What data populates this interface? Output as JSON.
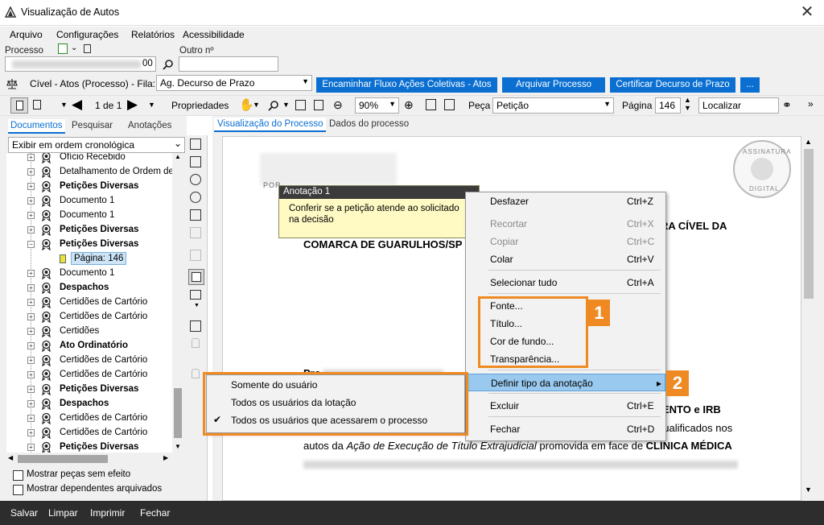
{
  "window": {
    "title": "Visualização de Autos",
    "close_glyph": "✕"
  },
  "menu": [
    "Arquivo",
    "Configurações",
    "Relatórios",
    "Acessibilidade"
  ],
  "fields": {
    "processo_label": "Processo",
    "processo_value": "00",
    "outro_label": "Outro nº",
    "outro_value": ""
  },
  "row2": {
    "context": "Cível - Atos (Processo) - Fila:",
    "fila_value": "Ag. Decurso de Prazo",
    "buttons": [
      "Encaminhar Fluxo Ações Coletivas - Atos",
      "Arquivar Processo",
      "Certificar Decurso de Prazo",
      "..."
    ]
  },
  "toolbar": {
    "page_counter": "1 de 1",
    "propriedades": "Propriedades",
    "zoom": "90%",
    "peca_label": "Peça",
    "peca_value": "Petição",
    "pagina_label": "Página",
    "pagina_value": "146",
    "localizar": "Localizar"
  },
  "left_tabs": [
    "Documentos",
    "Pesquisar",
    "Anotações"
  ],
  "order_select": "Exibir em ordem cronológica",
  "tree": [
    {
      "label": "Ofício Recebido",
      "bold": false
    },
    {
      "label": "Detalhamento de Ordem de",
      "bold": false
    },
    {
      "label": "Petições Diversas",
      "bold": true
    },
    {
      "label": "Documento 1",
      "bold": false
    },
    {
      "label": "Documento 1",
      "bold": false
    },
    {
      "label": "Petições Diversas",
      "bold": true
    },
    {
      "label": "Petições Diversas",
      "bold": true,
      "expanded": true
    },
    {
      "label": "Página: 146",
      "bold": false,
      "child": true,
      "selected": true
    },
    {
      "label": "Documento 1",
      "bold": false
    },
    {
      "label": "Despachos",
      "bold": true
    },
    {
      "label": "Certidões de Cartório",
      "bold": false
    },
    {
      "label": "Certidões de Cartório",
      "bold": false
    },
    {
      "label": "Certidões",
      "bold": false
    },
    {
      "label": "Ato Ordinatório",
      "bold": true
    },
    {
      "label": "Certidões de Cartório",
      "bold": false
    },
    {
      "label": "Certidões de Cartório",
      "bold": false
    },
    {
      "label": "Petições Diversas",
      "bold": true
    },
    {
      "label": "Despachos",
      "bold": true
    },
    {
      "label": "Certidões de Cartório",
      "bold": false
    },
    {
      "label": "Certidões de Cartório",
      "bold": false
    },
    {
      "label": "Petições Diversas",
      "bold": true
    }
  ],
  "checkboxes": [
    "Mostrar peças sem efeito",
    "Mostrar dependentes arquivados"
  ],
  "doc_tabs": [
    "Visualização do Processo",
    "Dados do processo"
  ],
  "document": {
    "header_fragment": "POR",
    "line1": "RA CÍVEL DA",
    "line2": "COMARCA DE GUARULHOS/SP",
    "line3_prefix": "Pro",
    "line4": "ENTO e IRB",
    "line5": "qualificados nos",
    "line6_a": "autos da ",
    "line6_b": "Ação de Execução de Título Extrajudicial",
    "line6_c": " promovida em face de ",
    "line6_d": "CLÍNICA MÉDICA",
    "stamp_top": "ASSINATURA",
    "stamp_bottom": "DIGITAL"
  },
  "annotation": {
    "title": "Anotação 1",
    "text": "Conferir se a petição atende ao solicitado na decisão"
  },
  "context_menu": [
    {
      "label": "Desfazer",
      "shortcut": "Ctrl+Z",
      "disabled": false
    },
    {
      "label": "Recortar",
      "shortcut": "Ctrl+X",
      "disabled": true
    },
    {
      "label": "Copiar",
      "shortcut": "Ctrl+C",
      "disabled": true
    },
    {
      "label": "Colar",
      "shortcut": "Ctrl+V",
      "disabled": false
    },
    {
      "label": "Selecionar tudo",
      "shortcut": "Ctrl+A",
      "disabled": false
    },
    {
      "label": "Fonte...",
      "shortcut": "",
      "disabled": false
    },
    {
      "label": "Título...",
      "shortcut": "",
      "disabled": false
    },
    {
      "label": "Cor de fundo...",
      "shortcut": "",
      "disabled": false
    },
    {
      "label": "Transparência...",
      "shortcut": "",
      "disabled": false
    },
    {
      "label": "Definir tipo da anotação",
      "shortcut": "▸",
      "disabled": false,
      "highlighted": true
    },
    {
      "label": "Excluir",
      "shortcut": "Ctrl+E",
      "disabled": false
    },
    {
      "label": "Fechar",
      "shortcut": "Ctrl+D",
      "disabled": false
    }
  ],
  "submenu": [
    {
      "label": "Somente do usuário",
      "checked": false
    },
    {
      "label": "Todos os usuários da lotação",
      "checked": false
    },
    {
      "label": "Todos os usuários que acessarem o processo",
      "checked": true
    }
  ],
  "badges": [
    "1",
    "2"
  ],
  "status": [
    "Salvar",
    "Limpar",
    "Imprimir",
    "Fechar"
  ],
  "colors": {
    "accent_blue": "#0a6fd1",
    "highlight_orange": "#ef8a22",
    "menu_highlight": "#99c9ef"
  }
}
